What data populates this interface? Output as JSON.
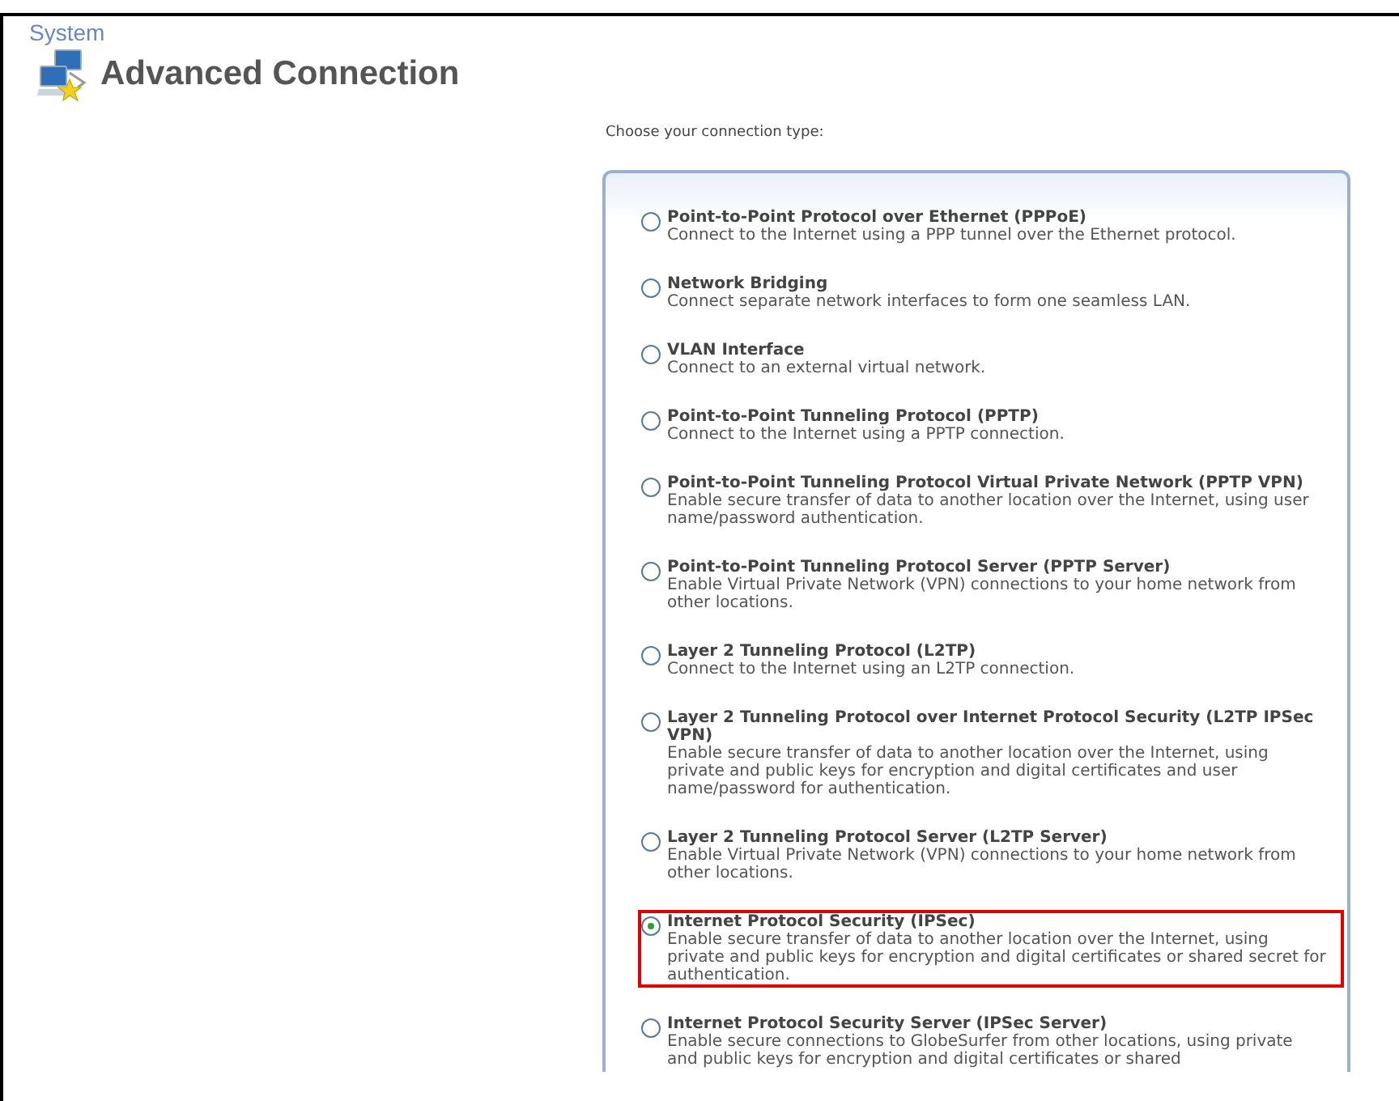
{
  "breadcrumb": "System",
  "title": "Advanced Connection",
  "prompt": "Choose your connection type:",
  "options": [
    {
      "label": "Point-to-Point Protocol over Ethernet (PPPoE)",
      "description": "Connect to the Internet using a PPP tunnel over the Ethernet protocol.",
      "selected": false
    },
    {
      "label": "Network Bridging",
      "description": "Connect separate network interfaces to form one seamless LAN.",
      "selected": false
    },
    {
      "label": "VLAN Interface",
      "description": "Connect to an external virtual network.",
      "selected": false
    },
    {
      "label": "Point-to-Point Tunneling Protocol (PPTP)",
      "description": "Connect to the Internet using a PPTP connection.",
      "selected": false
    },
    {
      "label": "Point-to-Point Tunneling Protocol Virtual Private Network (PPTP VPN)",
      "description": "Enable secure transfer of data to another location over the Internet, using user name/password authentication.",
      "selected": false
    },
    {
      "label": "Point-to-Point Tunneling Protocol Server (PPTP Server)",
      "description": "Enable Virtual Private Network (VPN) connections to your home network from other locations.",
      "selected": false
    },
    {
      "label": "Layer 2 Tunneling Protocol (L2TP)",
      "description": "Connect to the Internet using an L2TP connection.",
      "selected": false
    },
    {
      "label": "Layer 2 Tunneling Protocol over Internet Protocol Security (L2TP IPSec VPN)",
      "description": "Enable secure transfer of data to another location over the Internet, using private and public keys for encryption and digital certificates and user name/password for authentication.",
      "selected": false
    },
    {
      "label": "Layer 2 Tunneling Protocol Server (L2TP Server)",
      "description": "Enable Virtual Private Network (VPN) connections to your home network from other locations.",
      "selected": false
    },
    {
      "label": "Internet Protocol Security (IPSec)",
      "description": "Enable secure transfer of data to another location over the Internet, using private and public keys for encryption and digital certificates or shared secret for authentication.",
      "selected": true
    },
    {
      "label": "Internet Protocol Security Server (IPSec Server)",
      "description": "Enable secure connections to GlobeSurfer from other locations, using private and public keys for encryption and digital certificates or shared",
      "selected": false
    }
  ]
}
